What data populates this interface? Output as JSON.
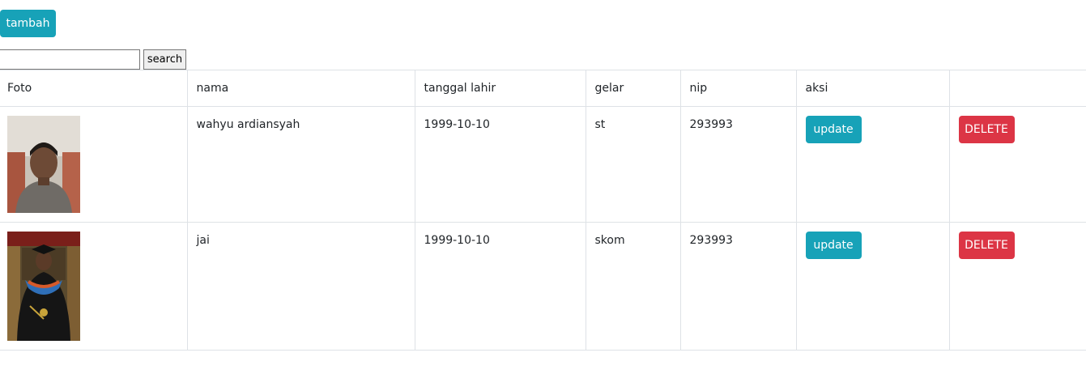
{
  "toolbar": {
    "add_label": "tambah"
  },
  "search": {
    "value": "",
    "placeholder": "",
    "button_label": "search"
  },
  "table": {
    "headers": [
      "Foto",
      "nama",
      "tanggal lahir",
      "gelar",
      "nip",
      "aksi"
    ],
    "rows": [
      {
        "photo_icon": "person-photo",
        "nama": "wahyu ardiansyah",
        "tanggal_lahir": "1999-10-10",
        "gelar": "st",
        "nip": "293993",
        "update_label": "update",
        "delete_label": "DELETE"
      },
      {
        "photo_icon": "graduation-photo",
        "nama": "jai",
        "tanggal_lahir": "1999-10-10",
        "gelar": "skom",
        "nip": "293993",
        "update_label": "update",
        "delete_label": "DELETE"
      }
    ]
  },
  "colors": {
    "info": "#17a2b8",
    "danger": "#dc3545",
    "border": "#dee2e6"
  }
}
